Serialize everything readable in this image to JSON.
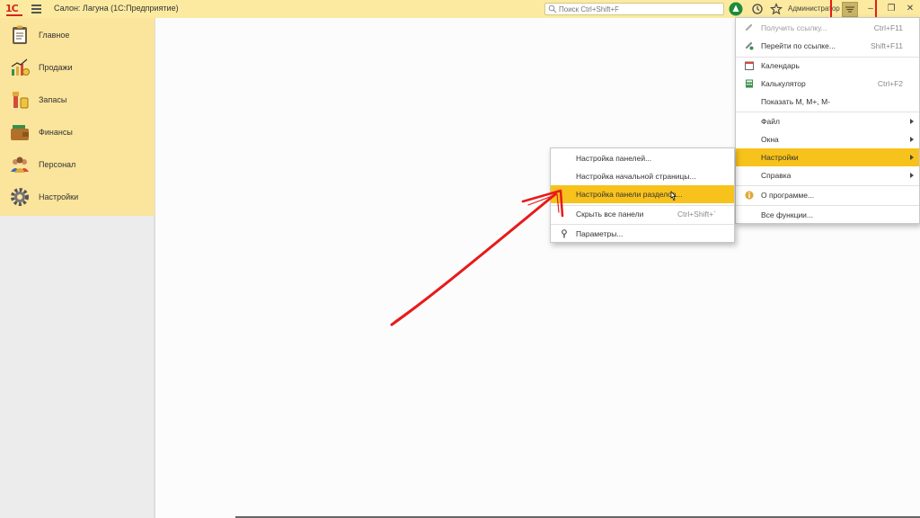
{
  "app": {
    "logo": "1С",
    "title": "Салон: Лагуна  (1С:Предприятие)"
  },
  "search": {
    "placeholder": "Поиск Ctrl+Shift+F"
  },
  "user": {
    "name": "Администратор"
  },
  "sidebar": {
    "items": [
      {
        "label": "Главное",
        "icon": "clipboard-icon"
      },
      {
        "label": "Продажи",
        "icon": "sales-chart-icon"
      },
      {
        "label": "Запасы",
        "icon": "cosmetics-icon"
      },
      {
        "label": "Финансы",
        "icon": "wallet-icon"
      },
      {
        "label": "Персонал",
        "icon": "people-icon"
      },
      {
        "label": "Настройки",
        "icon": "gear-icon"
      }
    ]
  },
  "main_menu": {
    "items": [
      {
        "label": "Получить ссылку...",
        "shortcut": "Ctrl+F11",
        "disabled": true,
        "icon": "link-icon"
      },
      {
        "label": "Перейти по ссылке...",
        "shortcut": "Shift+F11",
        "icon": "go-link-icon"
      },
      {
        "label": "Календарь",
        "icon": "calendar-icon"
      },
      {
        "label": "Калькулятор",
        "shortcut": "Ctrl+F2",
        "icon": "calculator-icon"
      },
      {
        "label": "Показать М, М+, М-"
      },
      {
        "label": "Файл",
        "submenu": true
      },
      {
        "label": "Окна",
        "submenu": true
      },
      {
        "label": "Настройки",
        "submenu": true,
        "highlighted": true
      },
      {
        "label": "Справка",
        "submenu": true
      },
      {
        "label": "О программе...",
        "icon": "info-icon"
      },
      {
        "label": "Все функции..."
      }
    ]
  },
  "settings_menu": {
    "items": [
      {
        "label": "Настройка панелей..."
      },
      {
        "label": "Настройка начальной страницы..."
      },
      {
        "label": "Настройка панели разделов...",
        "highlighted": true
      },
      {
        "label": "Скрыть все панели",
        "shortcut": "Ctrl+Shift+`"
      },
      {
        "label": "Параметры...",
        "icon": "wrench-icon"
      }
    ]
  },
  "colors": {
    "titlebar": "#fbeaa0",
    "sidebar": "#fbe49b",
    "highlight": "#f7c21b",
    "annotation": "#e81a1a"
  }
}
